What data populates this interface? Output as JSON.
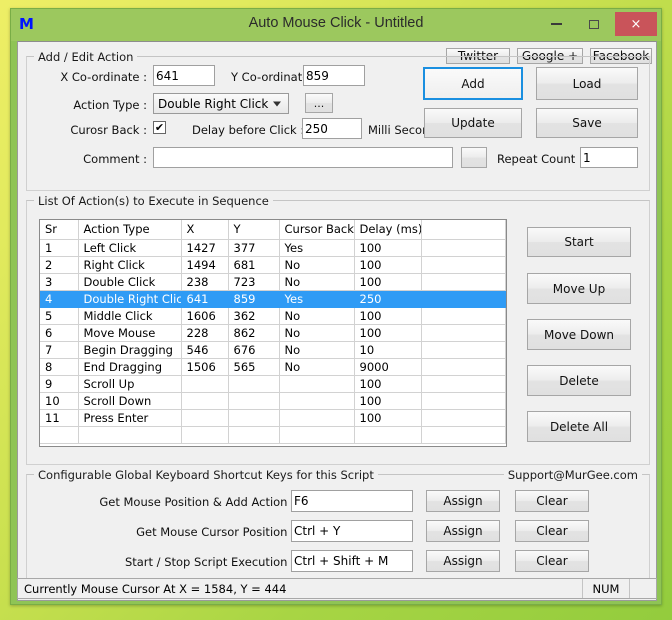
{
  "window": {
    "title": "Auto Mouse Click - Untitled",
    "icon": "M",
    "minimize": "–",
    "maximize": "□",
    "close": "×"
  },
  "social": {
    "twitter": "Twitter",
    "google": "Google +",
    "facebook": "Facebook"
  },
  "add_edit": {
    "legend": "Add / Edit Action",
    "x_label": "X Co-ordinate :",
    "x_value": "641",
    "y_label": "Y Co-ordinate :",
    "y_value": "859",
    "action_type_label": "Action Type :",
    "action_type_value": "Double Right Click",
    "ellipsis_button": "...",
    "cursor_back_label": "Curosr Back :",
    "cursor_back_checked": "✔",
    "delay_label": "Delay before Click :",
    "delay_value": "250",
    "delay_units": "Milli Second(s)",
    "comment_label": "Comment :",
    "comment_value": "",
    "repeat_label": "Repeat Count :",
    "repeat_value": "1",
    "add_button": "Add",
    "load_button": "Load",
    "update_button": "Update",
    "save_button": "Save"
  },
  "list": {
    "legend": "List Of Action(s) to Execute in Sequence",
    "columns": [
      "Sr",
      "Action Type",
      "X",
      "Y",
      "Cursor Back",
      "Delay (ms)",
      ""
    ],
    "selected_index": 3,
    "rows": [
      [
        "1",
        "Left Click",
        "1427",
        "377",
        "Yes",
        "100",
        ""
      ],
      [
        "2",
        "Right Click",
        "1494",
        "681",
        "No",
        "100",
        ""
      ],
      [
        "3",
        "Double Click",
        "238",
        "723",
        "No",
        "100",
        ""
      ],
      [
        "4",
        "Double Right Click",
        "641",
        "859",
        "Yes",
        "250",
        ""
      ],
      [
        "5",
        "Middle Click",
        "1606",
        "362",
        "No",
        "100",
        ""
      ],
      [
        "6",
        "Move Mouse",
        "228",
        "862",
        "No",
        "100",
        ""
      ],
      [
        "7",
        "Begin Dragging",
        "546",
        "676",
        "No",
        "10",
        ""
      ],
      [
        "8",
        "End Dragging",
        "1506",
        "565",
        "No",
        "9000",
        ""
      ],
      [
        "9",
        "Scroll Up",
        "",
        "",
        "",
        "100",
        ""
      ],
      [
        "10",
        "Scroll Down",
        "",
        "",
        "",
        "100",
        ""
      ],
      [
        "11",
        "Press Enter",
        "",
        "",
        "",
        "100",
        ""
      ],
      [
        "",
        "",
        "",
        "",
        "",
        "",
        ""
      ]
    ],
    "buttons": {
      "start": "Start",
      "move_up": "Move Up",
      "move_down": "Move Down",
      "delete": "Delete",
      "delete_all": "Delete All"
    }
  },
  "shortcuts": {
    "legend": "Configurable Global Keyboard Shortcut Keys for this Script",
    "support": "Support@MurGee.com",
    "rows": [
      {
        "label": "Get Mouse Position & Add Action :",
        "value": "F6",
        "assign": "Assign",
        "clear": "Clear"
      },
      {
        "label": "Get Mouse Cursor Position :",
        "value": "Ctrl + Y",
        "assign": "Assign",
        "clear": "Clear"
      },
      {
        "label": "Start / Stop Script Execution :",
        "value": "Ctrl + Shift + M",
        "assign": "Assign",
        "clear": "Clear"
      }
    ]
  },
  "status": {
    "text": "Currently Mouse Cursor At X = 1584, Y = 444",
    "num": "NUM"
  },
  "colors": {
    "frame": "#8fc455",
    "titlebar": "#9cc85e",
    "close": "#c9545a",
    "selection": "#2f9bf5",
    "focus": "#1a8fe0"
  }
}
